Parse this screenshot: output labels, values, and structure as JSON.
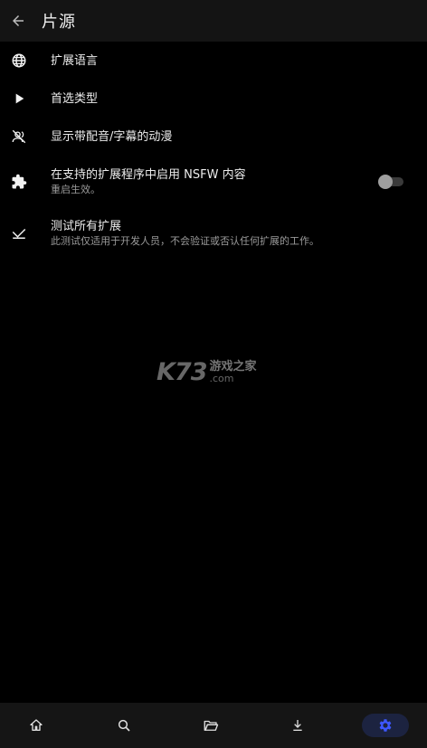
{
  "header": {
    "title": "片源"
  },
  "settings": [
    {
      "id": "languages",
      "icon": "globe-icon",
      "label": "扩展语言",
      "sub": ""
    },
    {
      "id": "preferred-type",
      "icon": "play-icon",
      "label": "首选类型",
      "sub": ""
    },
    {
      "id": "dub-sub",
      "icon": "voice-off-icon",
      "label": "显示带配音/字幕的动漫",
      "sub": ""
    },
    {
      "id": "nsfw",
      "icon": "puzzle-icon",
      "label": "在支持的扩展程序中启用 NSFW 内容",
      "sub": "重启生效。",
      "toggle": false
    },
    {
      "id": "test-all",
      "icon": "test-icon",
      "label": "测试所有扩展",
      "sub": "此测试仅适用于开发人员，不会验证或否认任何扩展的工作。"
    }
  ],
  "watermark": {
    "logo": "K73",
    "text_cn": "游戏之家",
    "text_domain": ".com"
  },
  "bottom_nav": [
    {
      "id": "home",
      "icon": "home-icon",
      "active": false
    },
    {
      "id": "search",
      "icon": "search-icon",
      "active": false
    },
    {
      "id": "library",
      "icon": "folder-open-icon",
      "active": false
    },
    {
      "id": "downloads",
      "icon": "download-icon",
      "active": false
    },
    {
      "id": "settings",
      "icon": "gear-icon",
      "active": true
    }
  ],
  "colors": {
    "background": "#000000",
    "topbar": "#141414",
    "accent": "#3d57ff",
    "active_pill": "#1c2340"
  }
}
